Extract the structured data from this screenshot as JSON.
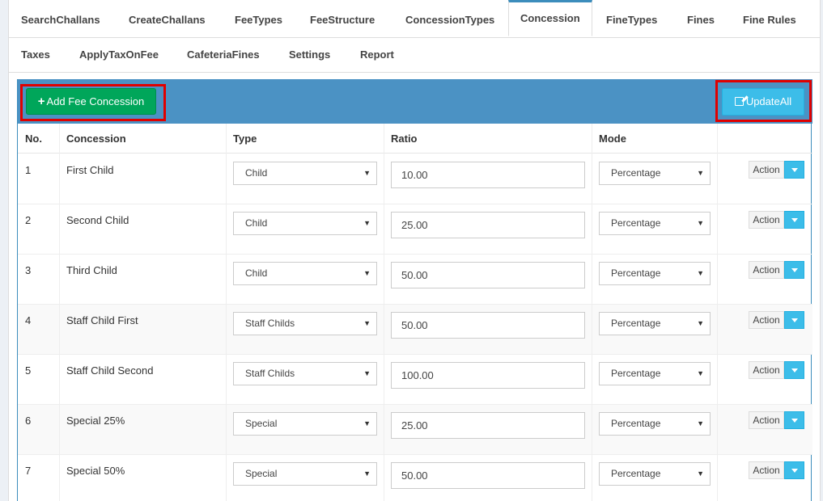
{
  "tabs_row1": [
    "SearchChallans",
    "CreateChallans",
    "FeeTypes",
    "FeeStructure",
    "ConcessionTypes",
    "Concession",
    "FineTypes",
    "Fines",
    "Fine Rules"
  ],
  "tabs_row2": [
    "Taxes",
    "ApplyTaxOnFee",
    "CafeteriaFines",
    "Settings",
    "Report"
  ],
  "active_tab": "Concession",
  "toolbar": {
    "add_label": "Add Fee Concession",
    "add_icon": "plus-icon",
    "update_label": "UpdateAll",
    "update_icon": "edit-icon"
  },
  "table": {
    "headers": [
      "No.",
      "Concession",
      "Type",
      "Ratio",
      "Mode"
    ],
    "action_label": "Action",
    "rows": [
      {
        "no": "1",
        "concession": "First Child",
        "type": "Child",
        "ratio": "10.00",
        "mode": "Percentage"
      },
      {
        "no": "2",
        "concession": "Second Child",
        "type": "Child",
        "ratio": "25.00",
        "mode": "Percentage"
      },
      {
        "no": "3",
        "concession": "Third Child",
        "type": "Child",
        "ratio": "50.00",
        "mode": "Percentage"
      },
      {
        "no": "4",
        "concession": "Staff Child First",
        "type": "Staff Childs",
        "ratio": "50.00",
        "mode": "Percentage"
      },
      {
        "no": "5",
        "concession": "Staff Child Second",
        "type": "Staff Childs",
        "ratio": "100.00",
        "mode": "Percentage"
      },
      {
        "no": "6",
        "concession": "Special 25%",
        "type": "Special",
        "ratio": "25.00",
        "mode": "Percentage"
      },
      {
        "no": "7",
        "concession": "Special 50%",
        "type": "Special",
        "ratio": "50.00",
        "mode": "Percentage"
      }
    ]
  },
  "colors": {
    "header_bar": "#4b92c4",
    "add_button": "#00a65a",
    "update_button": "#3cbde9",
    "highlight": "#e00000"
  }
}
